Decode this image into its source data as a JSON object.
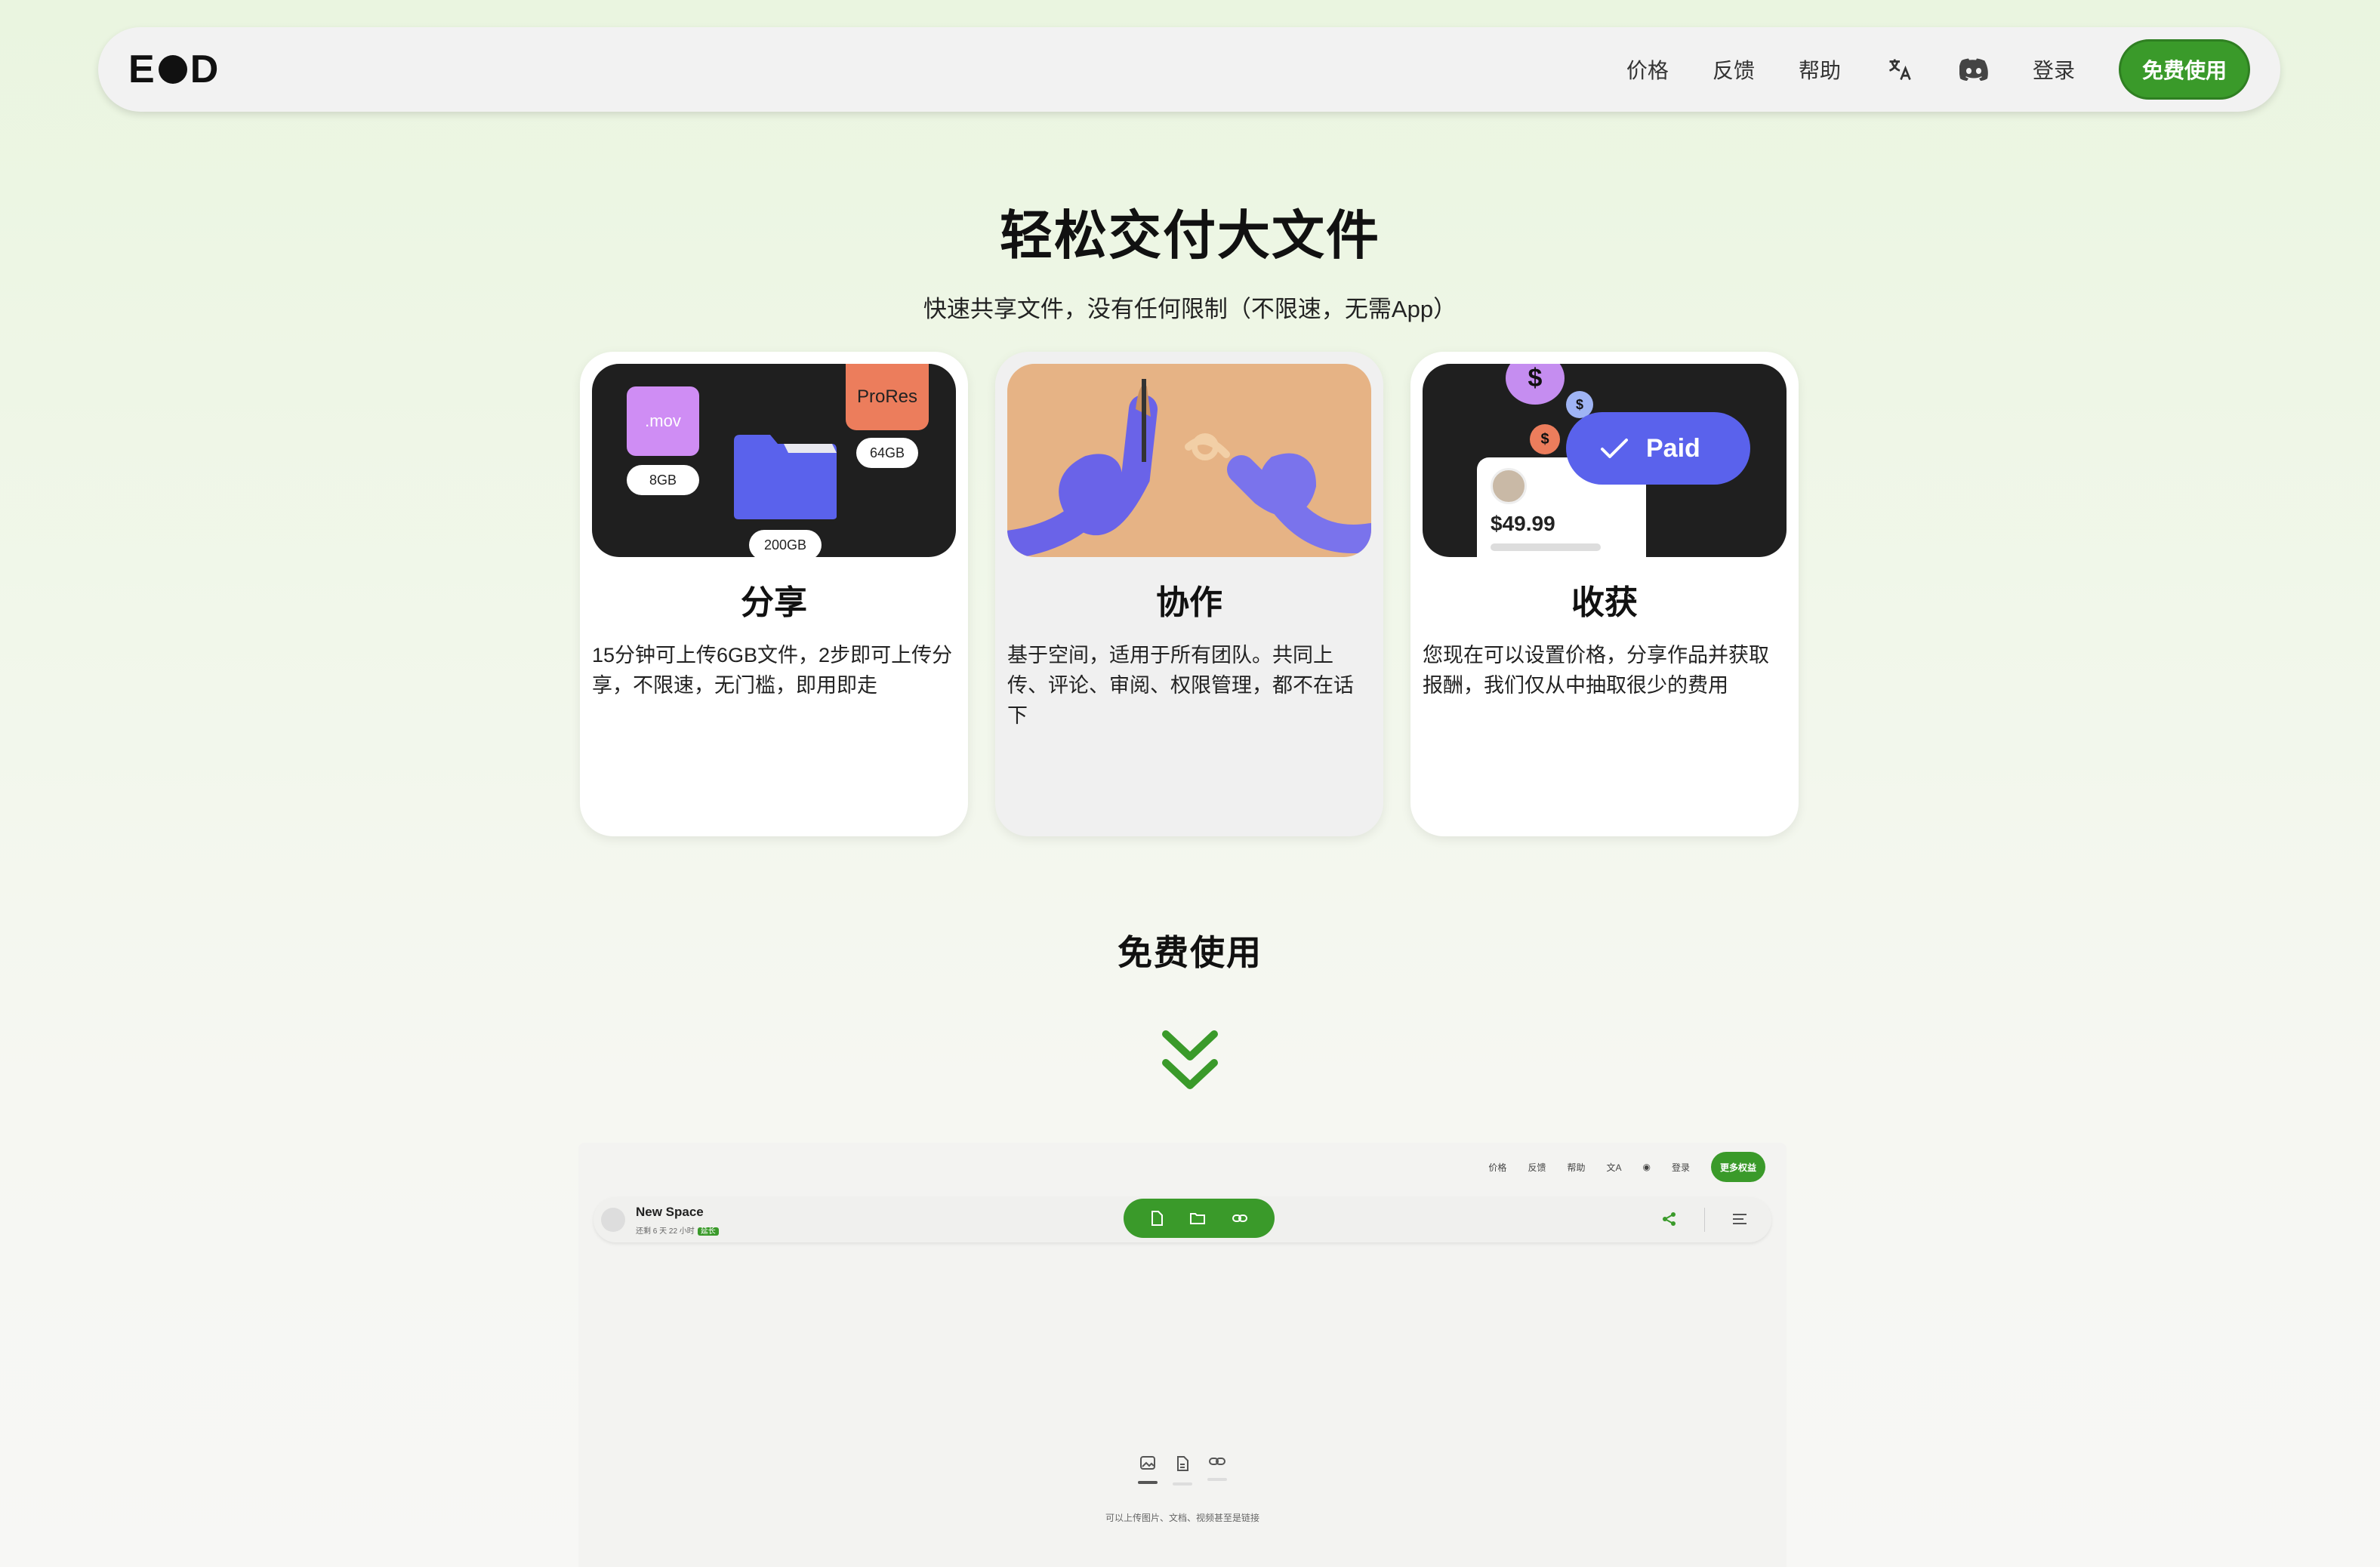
{
  "nav": {
    "logo_left": "E",
    "logo_right": "D",
    "links": [
      "价格",
      "反馈",
      "帮助"
    ],
    "login": "登录",
    "cta": "免费使用"
  },
  "hero": {
    "title": "轻松交付大文件",
    "subtitle": "快速共享文件，没有任何限制（不限速，无需App）"
  },
  "cards": [
    {
      "title": "分享",
      "desc": "15分钟可上传6GB文件，2步即可上传分享，不限速，无门槛，即用即走",
      "tags": {
        "mov": ".mov",
        "mov_size": "8GB",
        "prores": "ProRes",
        "prores_size": "64GB",
        "folder_size": "200GB"
      }
    },
    {
      "title": "协作",
      "desc": "基于空间，适用于所有团队。共同上传、评论、审阅、权限管理，都不在话下"
    },
    {
      "title": "收获",
      "desc": "您现在可以设置价格，分享作品并获取报酬，我们仅从中抽取很少的费用",
      "tags": {
        "paid": "Paid",
        "price": "$49.99",
        "dollar": "$"
      }
    }
  ],
  "section": {
    "free_title": "免费使用"
  },
  "preview": {
    "nav": [
      "价格",
      "反馈",
      "帮助",
      "登录"
    ],
    "cta": "更多权益",
    "space_name": "New Space",
    "space_meta": "还剩 6 天 22 小时",
    "space_badge": "延长",
    "hint": "可以上传图片、文档、视频甚至是链接"
  },
  "colors": {
    "accent": "#3a9a2a",
    "purple": "#6a63e8",
    "orange": "#ec7d5c",
    "sand": "#e6b385"
  }
}
